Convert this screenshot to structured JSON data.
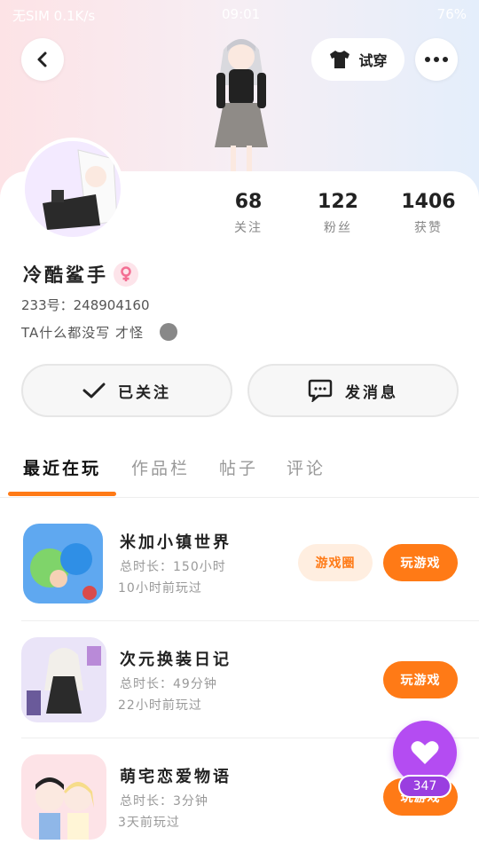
{
  "status_bar": {
    "left": "无SIM 0.1K/s",
    "time": "09:01",
    "battery": "76%"
  },
  "header": {
    "try_on_label": "试穿"
  },
  "stats": [
    {
      "value": "68",
      "label": "关注"
    },
    {
      "value": "122",
      "label": "粉丝"
    },
    {
      "value": "1406",
      "label": "获赞"
    }
  ],
  "profile": {
    "username": "冷酷鲨手",
    "user_id": "233号：248904160",
    "bio": "TA什么都没写 才怪"
  },
  "actions": {
    "follow_label": "已关注",
    "message_label": "发消息"
  },
  "tabs": [
    {
      "label": "最近在玩"
    },
    {
      "label": "作品栏"
    },
    {
      "label": "帖子"
    },
    {
      "label": "评论"
    }
  ],
  "games": [
    {
      "title": "米加小镇世界",
      "total_time": "总时长：150小时",
      "last_played": "10小时前玩过",
      "circle_label": "游戏圈",
      "play_label": "玩游戏"
    },
    {
      "title": "次元换装日记",
      "total_time": "总时长：49分钟",
      "last_played": "22小时前玩过",
      "play_label": "玩游戏"
    },
    {
      "title": "萌宅恋爱物语",
      "total_time": "总时长：3分钟",
      "last_played": "3天前玩过",
      "play_label": "玩游戏"
    }
  ],
  "like_fab": {
    "count": "347"
  },
  "colors": {
    "accent": "#ff7a16",
    "accent_soft": "#ffeee0",
    "fab": "#b44cf2"
  }
}
